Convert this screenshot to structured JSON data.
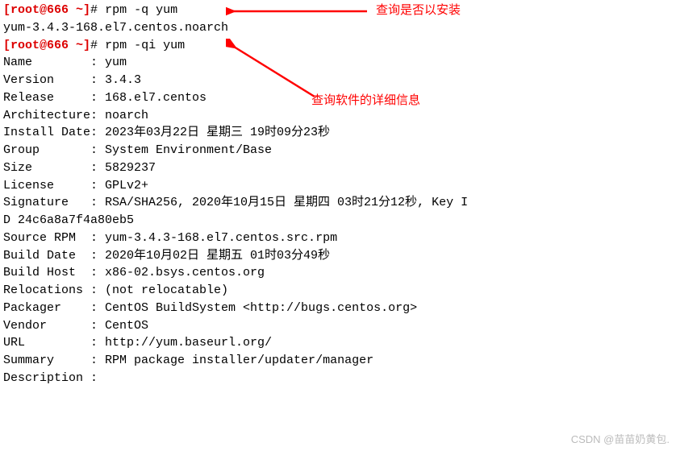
{
  "prompt1": {
    "prefix": "[root@666 ~]",
    "hash": "#",
    "command": "rpm -q yum"
  },
  "output1": "yum-3.4.3-168.el7.centos.noarch",
  "prompt2": {
    "prefix": "[root@666 ~]",
    "hash": "#",
    "command": "rpm -qi yum"
  },
  "fields": {
    "name": "Name        : yum",
    "version": "Version     : 3.4.3",
    "release": "Release     : 168.el7.centos",
    "architecture": "Architecture: noarch",
    "install_date": "Install Date: 2023年03月22日 星期三 19时09分23秒",
    "group": "Group       : System Environment/Base",
    "size": "Size        : 5829237",
    "license": "License     : GPLv2+",
    "signature1": "Signature   : RSA/SHA256, 2020年10月15日 星期四 03时21分12秒, Key I",
    "signature2": "D 24c6a8a7f4a80eb5",
    "source_rpm": "Source RPM  : yum-3.4.3-168.el7.centos.src.rpm",
    "build_date": "Build Date  : 2020年10月02日 星期五 01时03分49秒",
    "build_host": "Build Host  : x86-02.bsys.centos.org",
    "relocations": "Relocations : (not relocatable)",
    "packager": "Packager    : CentOS BuildSystem <http://bugs.centos.org>",
    "vendor": "Vendor      : CentOS",
    "url": "URL         : http://yum.baseurl.org/",
    "summary": "Summary     : RPM package installer/updater/manager",
    "description": "Description :"
  },
  "annotations": {
    "anno1": "查询是否以安装",
    "anno2": "查询软件的详细信息"
  },
  "watermark": "CSDN @苗苗奶黄包."
}
